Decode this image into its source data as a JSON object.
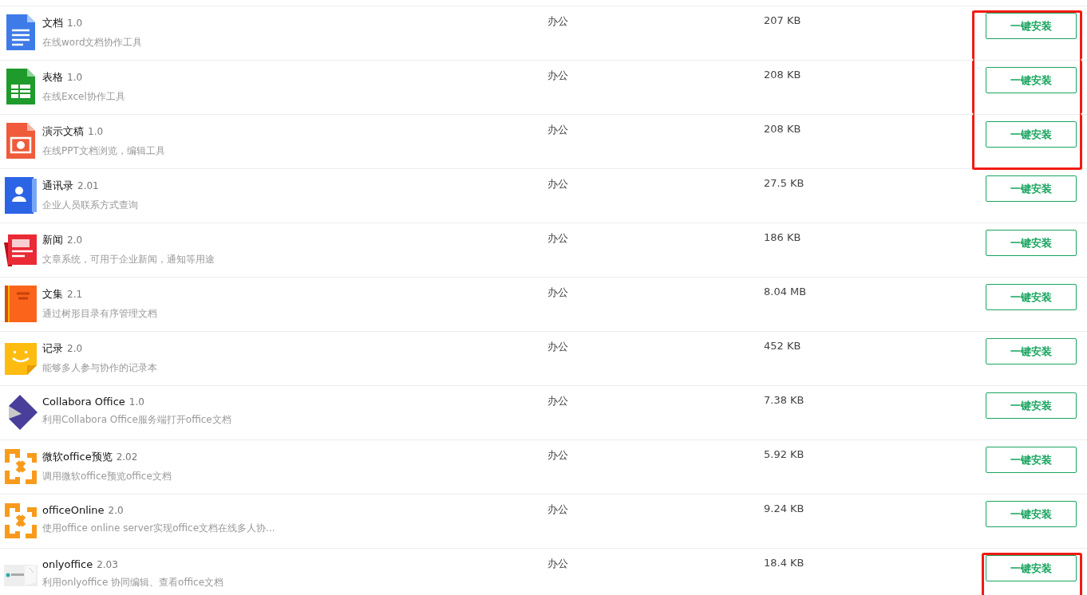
{
  "apps": [
    {
      "kind": "doc",
      "name": "文档",
      "version": "1.0",
      "description": "在线word文档协作工具",
      "category": "办公",
      "size": "207 KB",
      "button": "一键安装",
      "highlighted": true
    },
    {
      "kind": "sheet",
      "name": "表格",
      "version": "1.0",
      "description": "在线Excel协作工具",
      "category": "办公",
      "size": "208 KB",
      "button": "一键安装",
      "highlighted": true
    },
    {
      "kind": "slides",
      "name": "演示文稿",
      "version": "1.0",
      "description": "在线PPT文档浏览，编辑工具",
      "category": "办公",
      "size": "208 KB",
      "button": "一键安装",
      "highlighted": true
    },
    {
      "kind": "contacts",
      "name": "通讯录",
      "version": "2.01",
      "description": "企业人员联系方式查询",
      "category": "办公",
      "size": "27.5 KB",
      "button": "一键安装",
      "highlighted": false
    },
    {
      "kind": "news",
      "name": "新闻",
      "version": "2.0",
      "description": "文章系统，可用于企业新闻，通知等用途",
      "category": "办公",
      "size": "186 KB",
      "button": "一键安装",
      "highlighted": false
    },
    {
      "kind": "book",
      "name": "文集",
      "version": "2.1",
      "description": "通过树形目录有序管理文档",
      "category": "办公",
      "size": "8.04 MB",
      "button": "一键安装",
      "highlighted": false
    },
    {
      "kind": "note",
      "name": "记录",
      "version": "2.0",
      "description": "能够多人参与协作的记录本",
      "category": "办公",
      "size": "452 KB",
      "button": "一键安装",
      "highlighted": false
    },
    {
      "kind": "collabora",
      "name": "Collabora Office",
      "version": "1.0",
      "description": "利用Collabora Office服务端打开office文档",
      "category": "办公",
      "size": "7.38 KB",
      "button": "一键安装",
      "highlighted": false
    },
    {
      "kind": "office",
      "name": "微软office预览",
      "version": "2.02",
      "description": "调用微软office预览office文档",
      "category": "办公",
      "size": "5.92 KB",
      "button": "一键安装",
      "highlighted": false
    },
    {
      "kind": "office",
      "name": "officeOnline",
      "version": "2.0",
      "description": "使用office online server实现office文档在线多人协...",
      "category": "办公",
      "size": "9.24 KB",
      "button": "一键安装",
      "highlighted": false
    },
    {
      "kind": "picture",
      "name": "onlyoffice",
      "version": "2.03",
      "description": "利用onlyoffice 协同编辑、查看office文档",
      "category": "办公",
      "size": "18.4 KB",
      "button": "一键安装",
      "highlighted": true
    }
  ]
}
